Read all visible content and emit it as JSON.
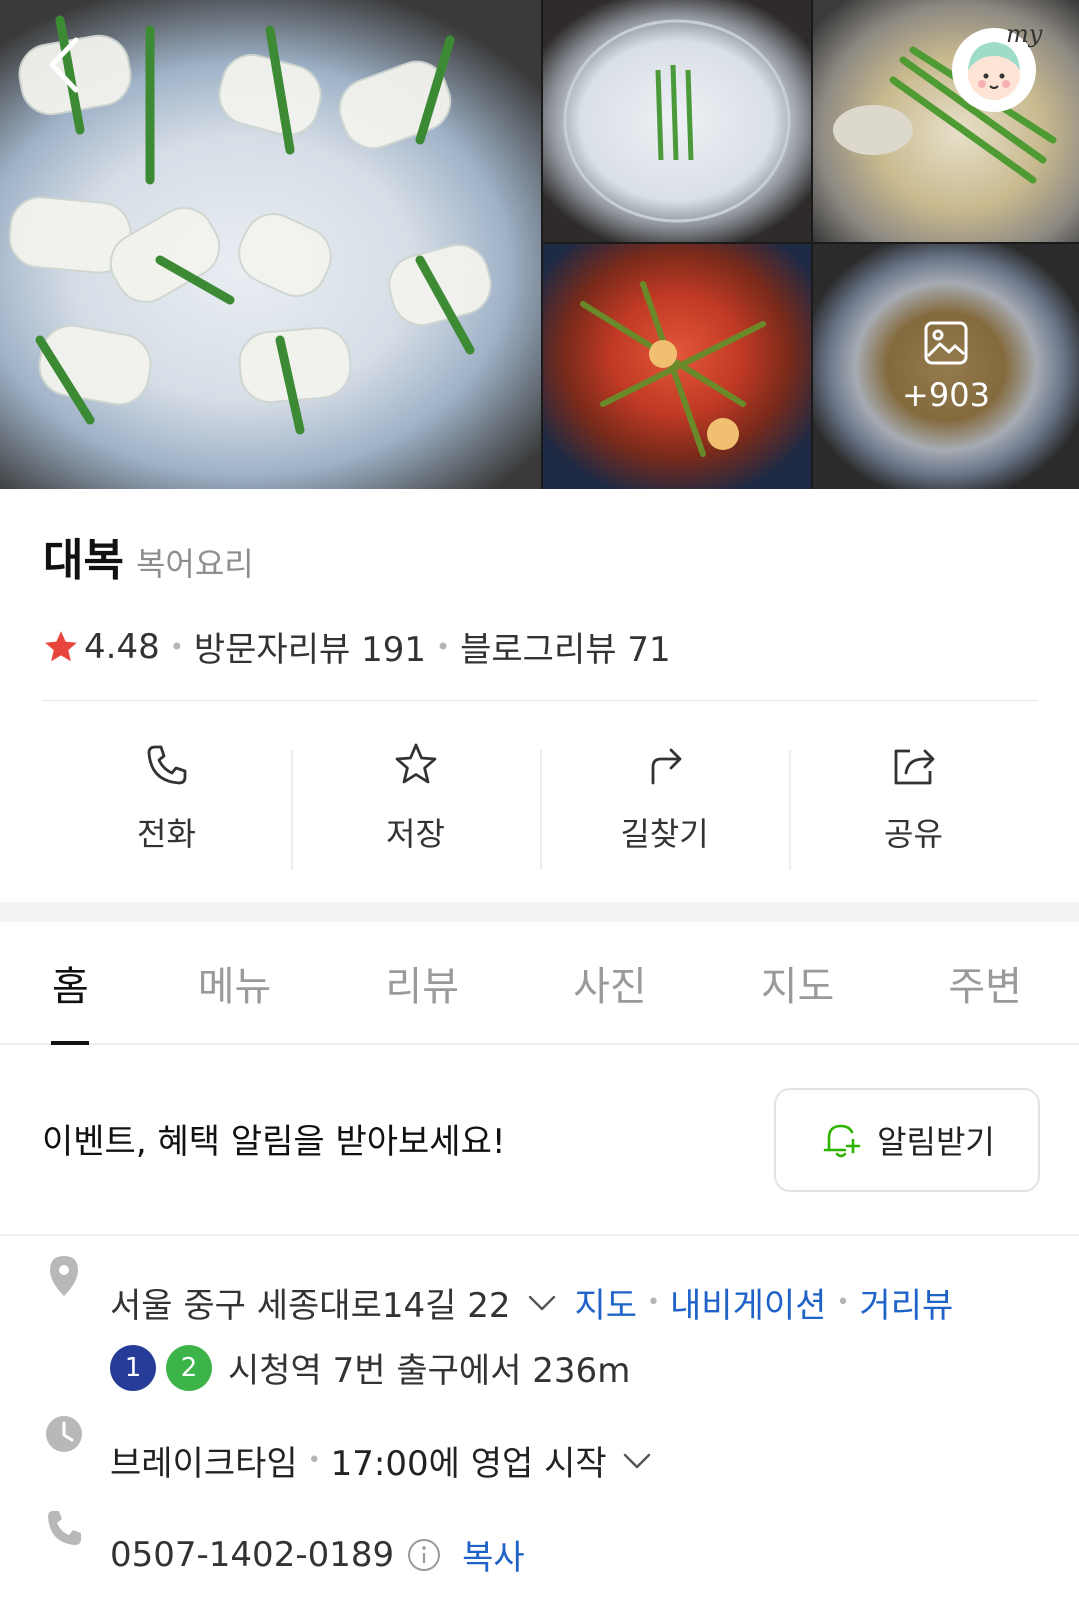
{
  "gallery": {
    "more_count": "+903",
    "my_label": "my"
  },
  "place": {
    "name": "대복",
    "category": "복어요리",
    "rating": "4.48",
    "visitor_reviews": "방문자리뷰 191",
    "blog_reviews": "블로그리뷰 71"
  },
  "actions": {
    "call": "전화",
    "save": "저장",
    "directions": "길찾기",
    "share": "공유"
  },
  "tabs": {
    "home": "홈",
    "menu": "메뉴",
    "review": "리뷰",
    "photo": "사진",
    "map": "지도",
    "nearby": "주변",
    "active": "home"
  },
  "notify": {
    "text": "이벤트, 혜택 알림을 받아보세요!",
    "button": "알림받기"
  },
  "info": {
    "address": "서울 중구 세종대로14길 22",
    "map_link": "지도",
    "navi_link": "내비게이션",
    "street_link": "거리뷰",
    "subway_lines": [
      "1",
      "2"
    ],
    "subway_text": "시청역 7번 출구에서 236m",
    "hours_status": "브레이크타임",
    "hours_text": "17:00에 영업 시작",
    "phone": "0507-1402-0189",
    "copy": "복사"
  },
  "colors": {
    "star": "#e8453c",
    "link": "#1f62c8",
    "line1": "#263c96",
    "line2": "#3cb44a",
    "notify_icon": "#2db400"
  }
}
